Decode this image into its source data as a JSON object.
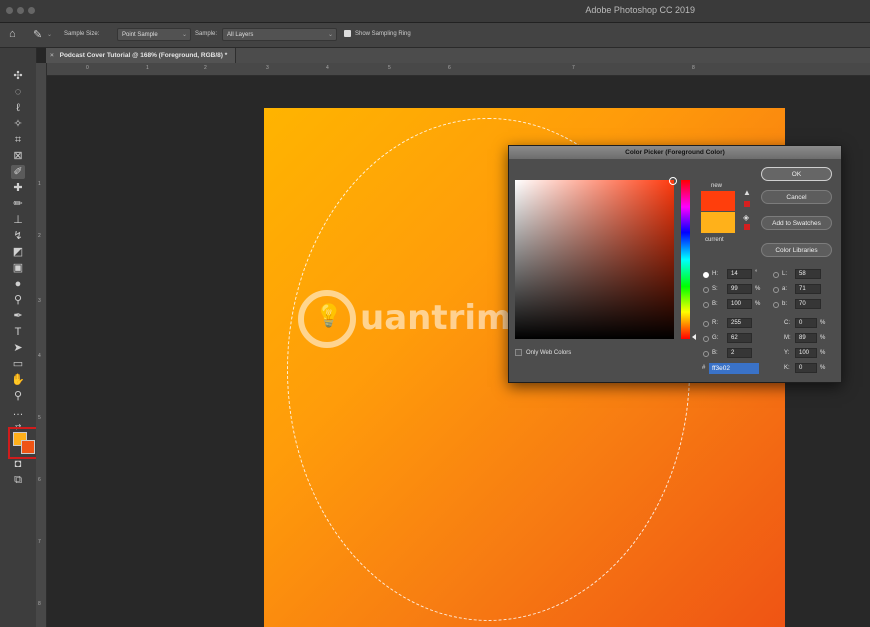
{
  "window": {
    "app_title": "Adobe Photoshop CC 2019"
  },
  "options_bar": {
    "sample_size_label": "Sample Size:",
    "sample_size_value": "Point Sample",
    "sample_label": "Sample:",
    "sample_value": "All Layers",
    "show_ring_label": "Show Sampling Ring"
  },
  "document": {
    "tab_title": "Podcast Cover Tutorial @ 168% (Foreground, RGB/8) *"
  },
  "rulers": {
    "top": [
      "0",
      "1",
      "2",
      "3",
      "4",
      "5",
      "6",
      "7",
      "8"
    ],
    "left": [
      "1",
      "2",
      "3",
      "4",
      "5",
      "6",
      "7",
      "8"
    ]
  },
  "colors": {
    "foreground": "#ffb11a",
    "background": "#ef5414",
    "new_color": "#ff3e0c",
    "current_color": "#ffb11a"
  },
  "color_picker": {
    "title": "Color Picker (Foreground Color)",
    "new_label": "new",
    "current_label": "current",
    "ok_label": "OK",
    "cancel_label": "Cancel",
    "add_swatches_label": "Add to Swatches",
    "libraries_label": "Color Libraries",
    "only_web_label": "Only Web Colors",
    "H": {
      "label": "H:",
      "value": "14",
      "unit": "°"
    },
    "S": {
      "label": "S:",
      "value": "99",
      "unit": "%"
    },
    "B": {
      "label": "B:",
      "value": "100",
      "unit": "%"
    },
    "R": {
      "label": "R:",
      "value": "255"
    },
    "G": {
      "label": "G:",
      "value": "62"
    },
    "Bl": {
      "label": "B:",
      "value": "2"
    },
    "L": {
      "label": "L:",
      "value": "58"
    },
    "a": {
      "label": "a:",
      "value": "71"
    },
    "b": {
      "label": "b:",
      "value": "70"
    },
    "C": {
      "label": "C:",
      "value": "0",
      "unit": "%"
    },
    "M": {
      "label": "M:",
      "value": "89",
      "unit": "%"
    },
    "Y": {
      "label": "Y:",
      "value": "100",
      "unit": "%"
    },
    "K": {
      "label": "K:",
      "value": "0",
      "unit": "%"
    },
    "hex_prefix": "#",
    "hex_value": "ff3e02"
  },
  "watermark": {
    "text": "uantrimang"
  }
}
